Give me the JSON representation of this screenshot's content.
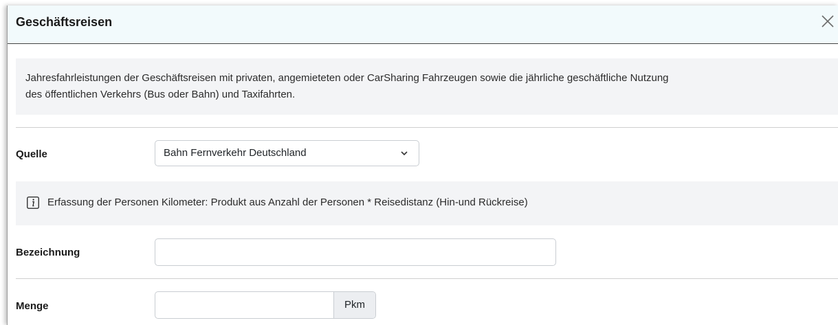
{
  "dialog": {
    "title": "Geschäftsreisen",
    "close_icon": "close-icon"
  },
  "description": {
    "line1": "Jahresfahrleistungen der Geschäftsreisen mit privaten, angemieteten oder CarSharing Fahrzeugen sowie die jährliche geschäftliche Nutzung",
    "line2": "des öffentlichen Verkehrs (Bus oder Bahn) und Taxifahrten."
  },
  "form": {
    "source": {
      "label": "Quelle",
      "value": "Bahn Fernverkehr Deutschland",
      "icon": "chevron-down-icon"
    },
    "info": {
      "icon": "info-icon",
      "text": "Erfassung der Personen Kilometer: Produkt aus Anzahl der Personen * Reisedistanz (Hin-und Rückreise)"
    },
    "designation": {
      "label": "Bezeichnung",
      "value": ""
    },
    "quantity": {
      "label": "Menge",
      "value": "",
      "unit": "Pkm"
    }
  },
  "colors": {
    "header_bg": "#f2fafc",
    "panel_bg": "#f3f4f6",
    "border": "#c9cdd2",
    "unit_bg": "#eceef1"
  }
}
